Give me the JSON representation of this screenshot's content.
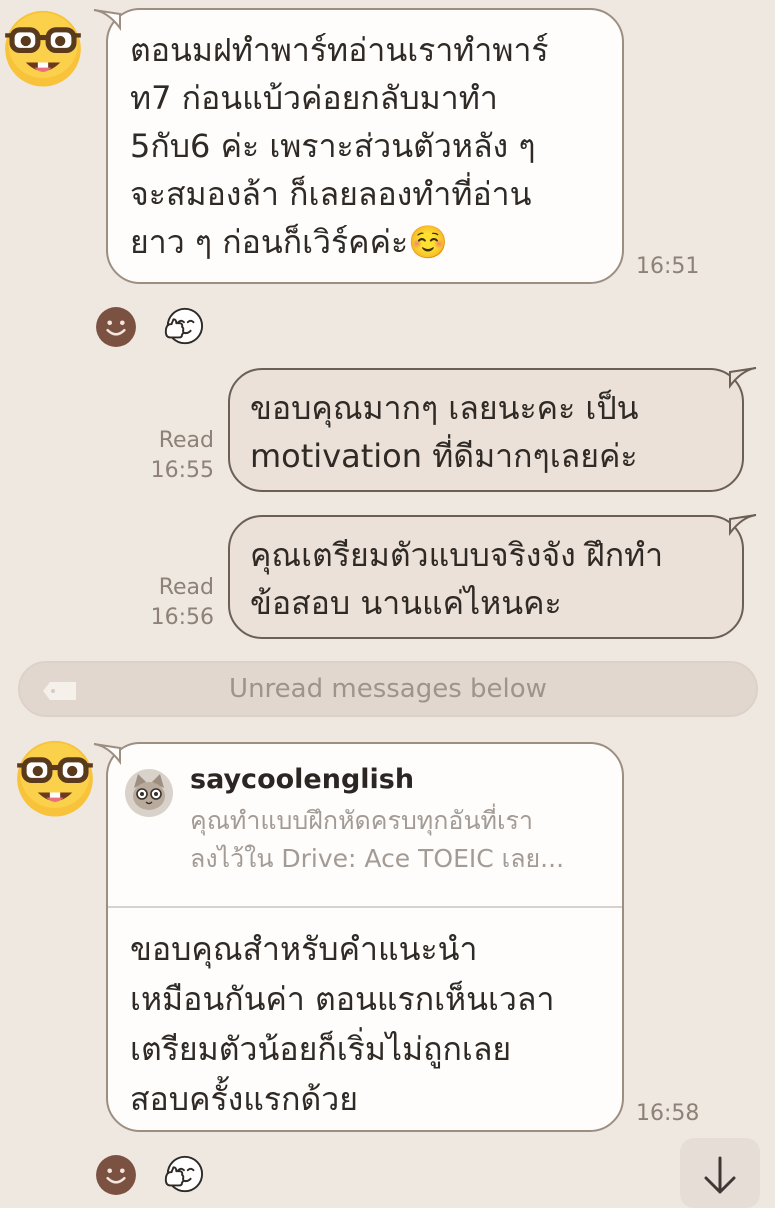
{
  "messages": [
    {
      "direction": "incoming",
      "text": "ตอนมฝทำพาร์ทอ่านเราทำพาร์\nท7 ก่อนแบ้วค่อยกลับมาทำ\n5กับ6 ค่ะ เพราะส่วนตัวหลัง ๆ\nจะสมองล้า ก็เลยลองทำที่อ่าน\nยาว ๆ ก่อนก็เวิร์คค่ะ☺️",
      "time": "16:51"
    },
    {
      "direction": "outgoing",
      "text": "ขอบคุณมากๆ เลยนะคะ เป็น\nmotivation ที่ดีมากๆเลยค่ะ",
      "read_label": "Read",
      "time": "16:55"
    },
    {
      "direction": "outgoing",
      "text": "คุณเตรียมตัวแบบจริงจัง ฝึกทำ\nข้อสอบ นานแค่ไหนคะ",
      "read_label": "Read",
      "time": "16:56"
    },
    {
      "direction": "incoming",
      "quote": {
        "name": "saycoolenglish",
        "text": "คุณทำแบบฝึกหัดครบทุกอันที่เรา\nลงไว้ใน Drive: Ace TOEIC เลย..."
      },
      "text": "ขอบคุณสำหรับคำแนะนำ\nเหมือนกันค่า ตอนแรกเห็นเวลา\nเตรียมตัวน้อยก็เริ่มไม่ถูกเลย\nสอบครั้งแรกด้วย",
      "time": "16:58"
    }
  ],
  "divider": {
    "label": "Unread messages below"
  },
  "icons": {
    "avatar": "nerd-face-emoji",
    "react": "smiley-face-icon",
    "sticker": "thumbs-up-face-icon",
    "tag": "tag-icon",
    "scroll": "arrow-down-icon"
  },
  "colors": {
    "background": "#efe8e1",
    "incoming_bubble": "#fffdfb",
    "outgoing_bubble": "#ebe1d8",
    "react_brown": "#7b5242"
  }
}
